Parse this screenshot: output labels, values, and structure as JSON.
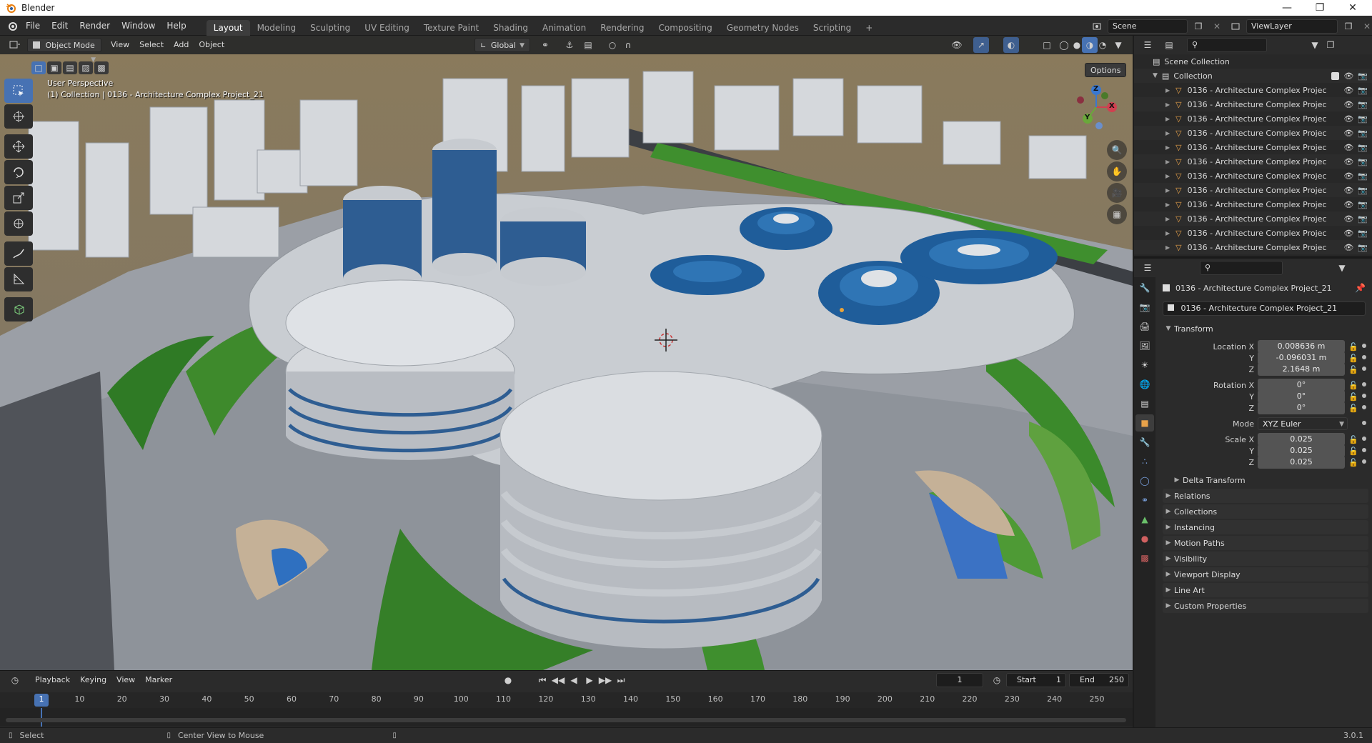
{
  "window": {
    "title": "Blender"
  },
  "menus": [
    "File",
    "Edit",
    "Render",
    "Window",
    "Help"
  ],
  "workspaces": [
    "Layout",
    "Modeling",
    "Sculpting",
    "UV Editing",
    "Texture Paint",
    "Shading",
    "Animation",
    "Rendering",
    "Compositing",
    "Geometry Nodes",
    "Scripting"
  ],
  "workspace_add": "+",
  "scene": {
    "name": "Scene",
    "view_layer": "ViewLayer"
  },
  "viewport": {
    "mode": "Object Mode",
    "menus": [
      "View",
      "Select",
      "Add",
      "Object"
    ],
    "orientation": "Global",
    "options_label": "Options",
    "overlay_line1": "User Perspective",
    "overlay_line2": "(1) Collection | 0136 - Architecture Complex Project_21",
    "gizmo": {
      "x": "X",
      "y": "Y",
      "z": "Z"
    }
  },
  "outliner": {
    "scene_collection": "Scene Collection",
    "collection": "Collection",
    "items": [
      "0136 - Architecture Complex Projec",
      "0136 - Architecture Complex Projec",
      "0136 - Architecture Complex Projec",
      "0136 - Architecture Complex Projec",
      "0136 - Architecture Complex Projec",
      "0136 - Architecture Complex Projec",
      "0136 - Architecture Complex Projec",
      "0136 - Architecture Complex Projec",
      "0136 - Architecture Complex Projec",
      "0136 - Architecture Complex Projec",
      "0136 - Architecture Complex Projec",
      "0136 - Architecture Complex Projec"
    ]
  },
  "properties": {
    "object_name": "0136 - Architecture Complex Project_21",
    "datablock_name": "0136 - Architecture Complex Project_21",
    "transform_label": "Transform",
    "location": {
      "label": "Location X",
      "x": "0.008636 m",
      "y": "-0.096031 m",
      "z": "2.1648 m"
    },
    "rotation": {
      "label": "Rotation X",
      "x": "0°",
      "y": "0°",
      "z": "0°"
    },
    "mode": {
      "label": "Mode",
      "value": "XYZ Euler"
    },
    "scale": {
      "label": "Scale X",
      "x": "0.025",
      "y": "0.025",
      "z": "0.025"
    },
    "axis_y": "Y",
    "axis_z": "Z",
    "delta_transform": "Delta Transform",
    "panels": [
      "Relations",
      "Collections",
      "Instancing",
      "Motion Paths",
      "Visibility",
      "Viewport Display",
      "Line Art",
      "Custom Properties"
    ]
  },
  "timeline": {
    "menus": [
      "Playback",
      "Keying",
      "View",
      "Marker"
    ],
    "current_frame": "1",
    "start_label": "Start",
    "start": "1",
    "end_label": "End",
    "end": "250",
    "ticks": [
      "1",
      "10",
      "20",
      "30",
      "40",
      "50",
      "60",
      "70",
      "80",
      "90",
      "100",
      "110",
      "120",
      "130",
      "140",
      "150",
      "160",
      "170",
      "180",
      "190",
      "200",
      "210",
      "220",
      "230",
      "240",
      "250"
    ]
  },
  "statusbar": {
    "select": "Select",
    "center_view": "Center View to Mouse",
    "version": "3.0.1"
  },
  "colors": {
    "accent": "#4772b3",
    "background": "#1d1d1d",
    "panel": "#2b2b2b"
  }
}
